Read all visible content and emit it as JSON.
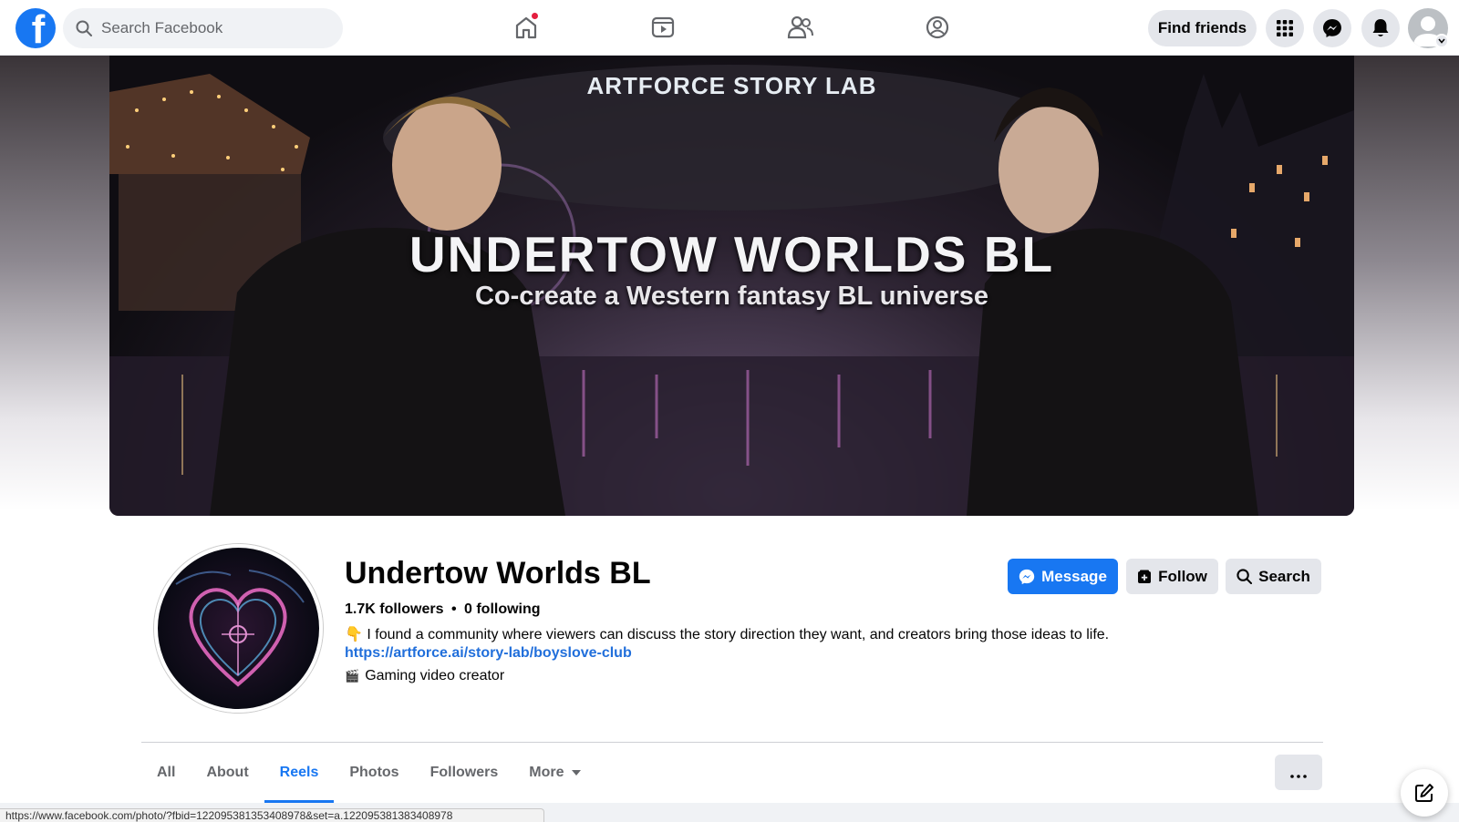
{
  "topbar": {
    "search_placeholder": "Search Facebook",
    "find_friends_label": "Find friends",
    "brand_color": "#1877f2"
  },
  "cover": {
    "top_label": "ARTFORCE STORY LAB",
    "title": "UNDERTOW WORLDS BL",
    "subtitle": "Co-create a Western fantasy BL universe"
  },
  "profile": {
    "name": "Undertow Worlds BL",
    "followers": "1.7K followers",
    "separator": "•",
    "following": "0 following",
    "bio_emoji": "👇",
    "bio": "I found a community where viewers can discuss the story direction they want, and creators bring those ideas to life.",
    "link": "https://artforce.ai/story-lab/boyslove-club",
    "category_icon": "🎬",
    "category": "Gaming video creator"
  },
  "actions": {
    "message_label": "Message",
    "follow_label": "Follow",
    "search_label": "Search"
  },
  "tabs": [
    {
      "label": "All"
    },
    {
      "label": "About"
    },
    {
      "label": "Reels",
      "active": true
    },
    {
      "label": "Photos"
    },
    {
      "label": "Followers"
    },
    {
      "label": "More"
    }
  ],
  "status_bar": {
    "url": "https://www.facebook.com/photo/?fbid=122095381353408978&set=a.122095381383408978"
  }
}
